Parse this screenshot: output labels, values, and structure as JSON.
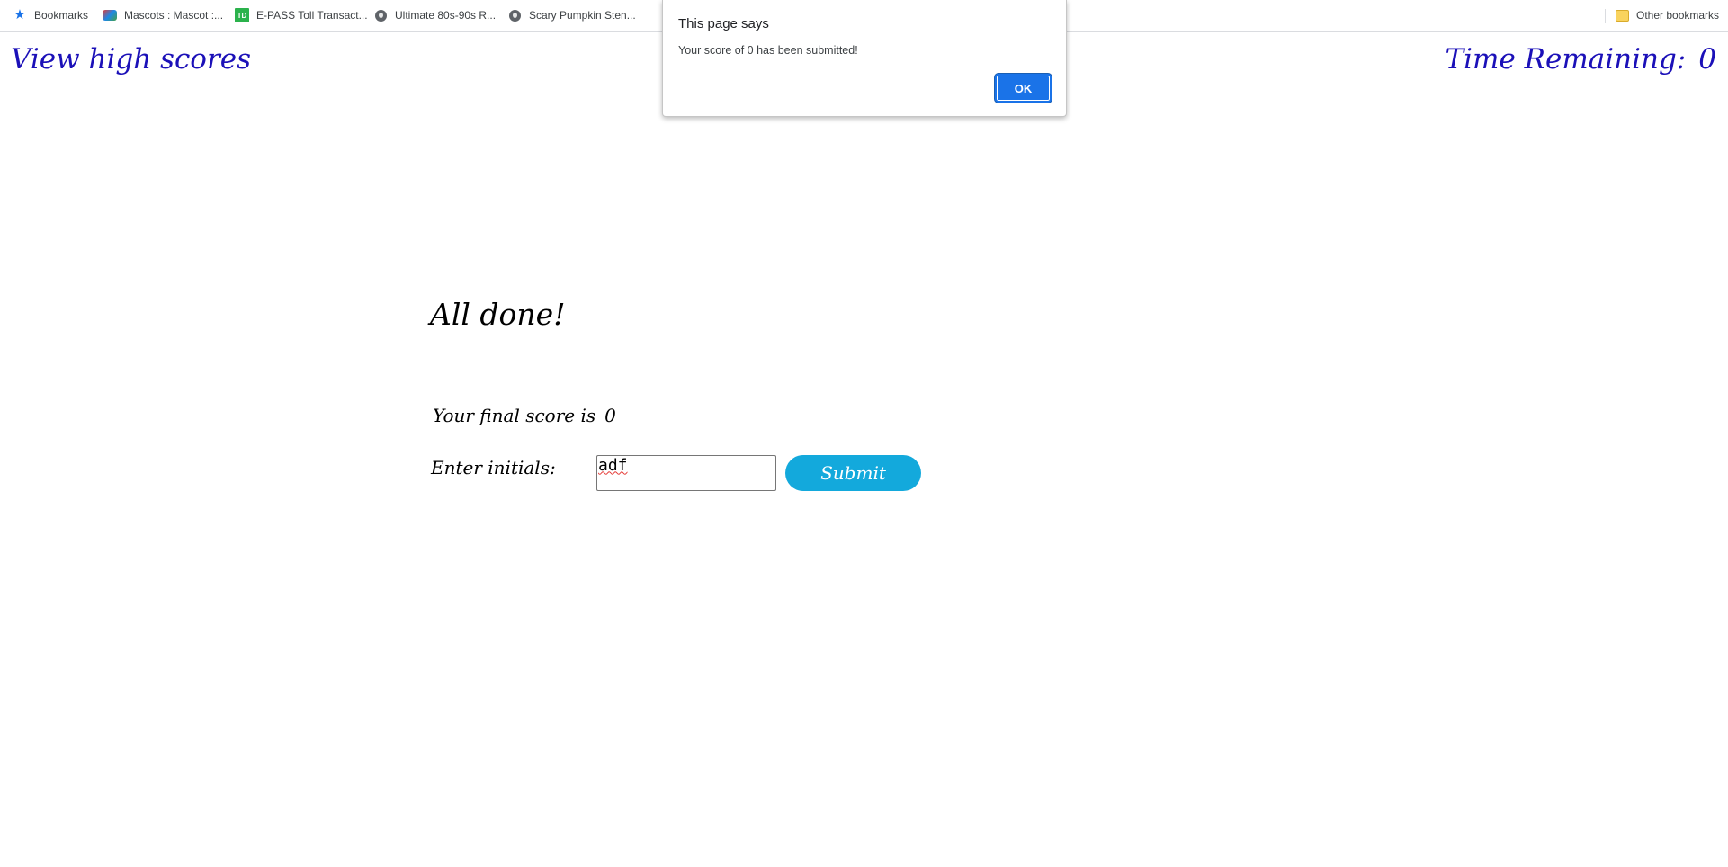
{
  "bookmarks_bar": {
    "items": [
      {
        "label": "Bookmarks",
        "icon": "star-icon"
      },
      {
        "label": "Mascots : Mascot :...",
        "icon": "mascot-favicon-icon"
      },
      {
        "label": "E-PASS Toll Transact...",
        "icon": "td-favicon-icon"
      },
      {
        "label": "Ultimate 80s-90s R...",
        "icon": "globe-icon"
      },
      {
        "label": "Scary Pumpkin Sten...",
        "icon": "globe-icon"
      }
    ],
    "other_bookmarks": {
      "label": "Other bookmarks",
      "icon": "folder-icon"
    }
  },
  "header": {
    "high_scores_link": "View high scores",
    "timer_label": "Time Remaining:",
    "timer_value": "0"
  },
  "main": {
    "title": "All done!",
    "final_score_label": "Your final score is",
    "final_score_value": "0",
    "initials_label": "Enter initials:",
    "initials_value": "adf",
    "submit_label": "Submit"
  },
  "dialog": {
    "title": "This page says",
    "message": "Your score of 0 has been submitted!",
    "ok_label": "OK"
  },
  "colors": {
    "header_text": "#1b10b8",
    "submit_button": "#13a9dc",
    "dialog_button": "#1a73e8"
  }
}
